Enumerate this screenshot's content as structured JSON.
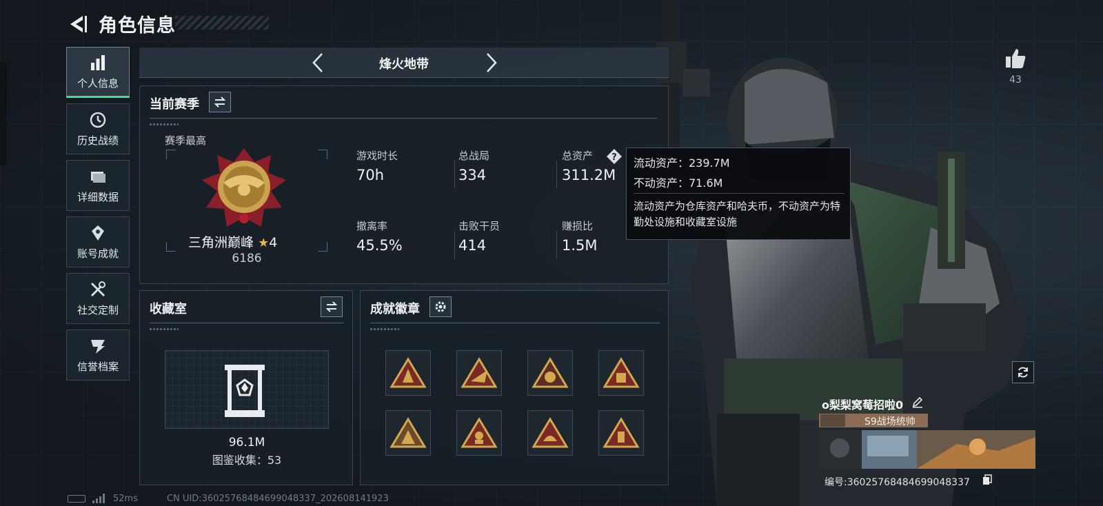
{
  "header": {
    "title": "角色信息"
  },
  "nav": {
    "items": [
      {
        "label": "个人信息",
        "icon": "bar-chart-icon",
        "active": true
      },
      {
        "label": "历史战绩",
        "icon": "history-icon"
      },
      {
        "label": "详细数据",
        "icon": "folder-icon"
      },
      {
        "label": "账号成就",
        "icon": "achievement-icon"
      },
      {
        "label": "社交定制",
        "icon": "tools-icon"
      },
      {
        "label": "信誉档案",
        "icon": "credit-icon"
      }
    ]
  },
  "mode": {
    "title": "烽火地带"
  },
  "season": {
    "title": "当前赛季",
    "best_label": "赛季最高",
    "rank_name": "三角洲巅峰",
    "rank_stars": "4",
    "rank_score": "6186",
    "stats": [
      {
        "label": "游戏时长",
        "value": "70h"
      },
      {
        "label": "总战局",
        "value": "334"
      },
      {
        "label": "总资产",
        "value": "311.2M"
      },
      {
        "label": "撤离率",
        "value": "45.5%"
      },
      {
        "label": "击败干员",
        "value": "414"
      },
      {
        "label": "赚损比",
        "value": "1.5M"
      }
    ]
  },
  "tooltip": {
    "liquid": "流动资产：239.7M",
    "fixed": "不动资产：71.6M",
    "desc": "流动资产为仓库资产和哈夫币，不动资产为特勤处设施和收藏室设施"
  },
  "vault": {
    "title": "收藏室",
    "value": "96.1M",
    "count": "图鉴收集：53"
  },
  "badges": {
    "title": "成就徽章"
  },
  "profile": {
    "likes": "43",
    "name": "o梨梨窝莓招啦0",
    "title_badge": "S9战场统帅",
    "id": "编号:3602576848469904833​7"
  },
  "status": {
    "latency": "52ms",
    "uid": "CN UID:36025768484699048337_202608141923"
  },
  "colors": {
    "accent": "#3de08f",
    "gold": "#c9a34f",
    "panel": "#18202a"
  }
}
